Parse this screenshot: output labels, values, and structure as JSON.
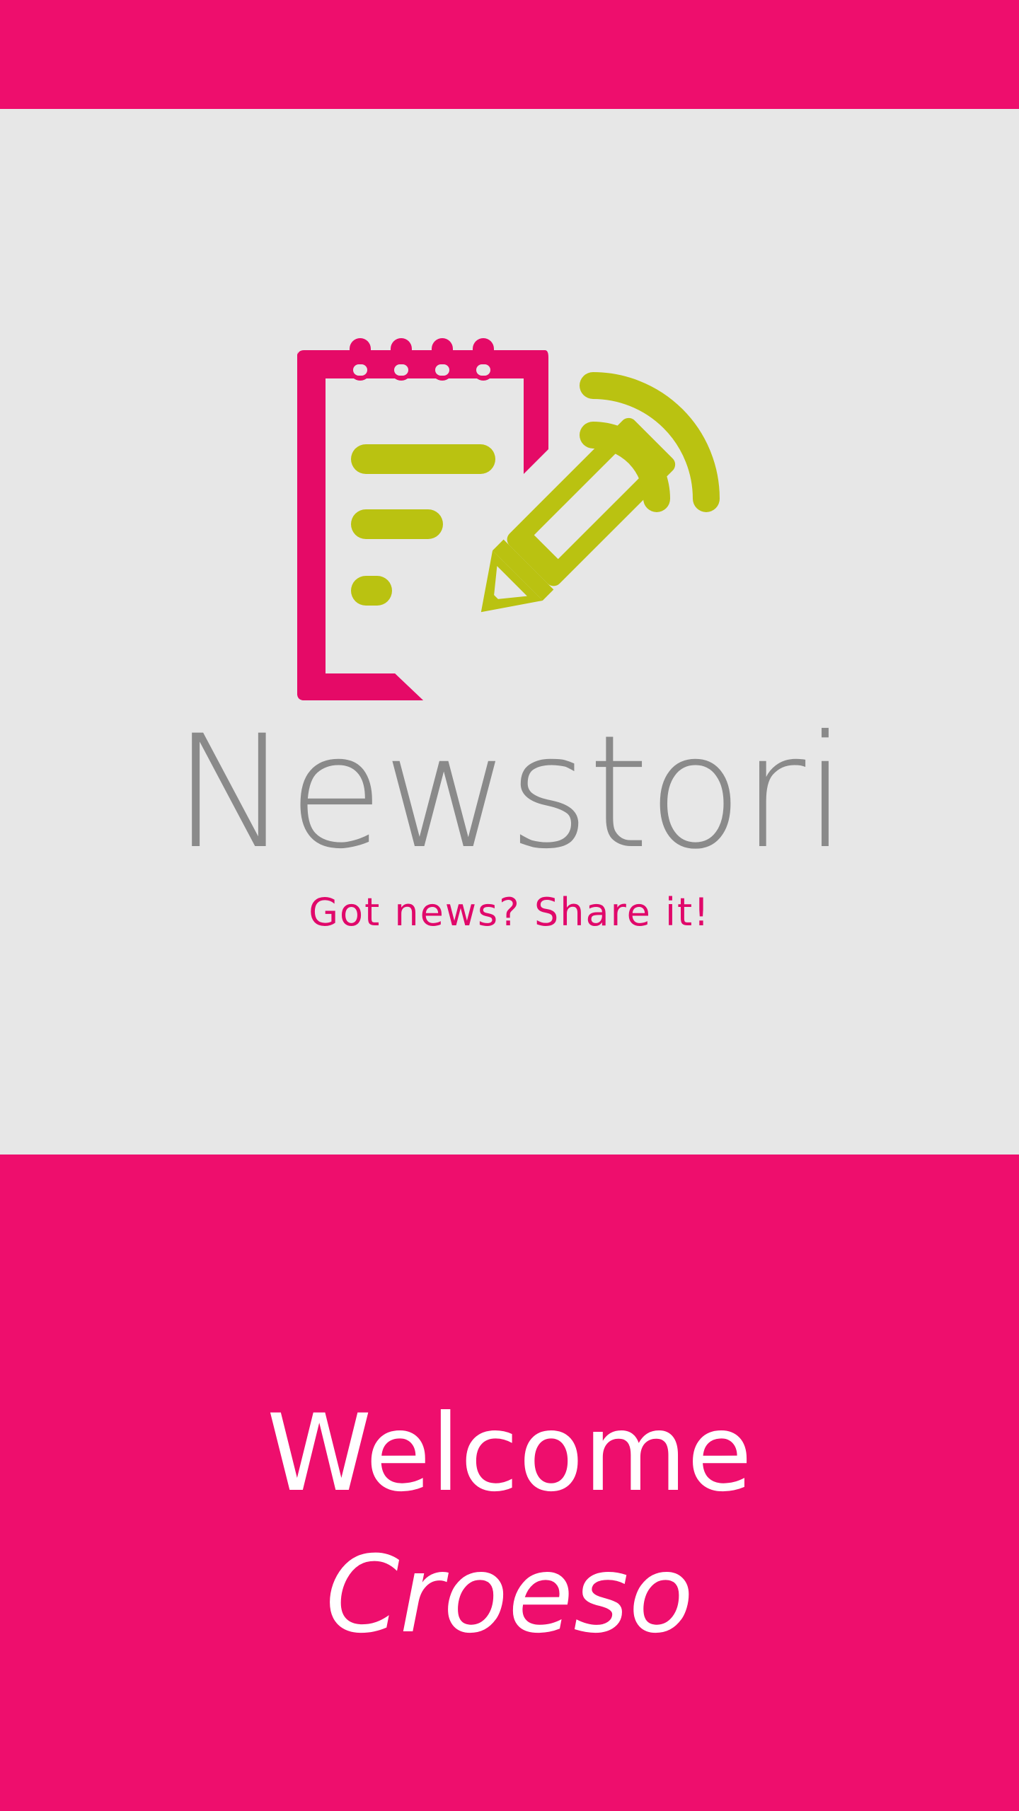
{
  "app": {
    "name": "Newstori",
    "tagline": "Got news? Share it!"
  },
  "welcome": {
    "line1": "Welcome",
    "line2": "Croeso"
  },
  "logo": {
    "icon": "notepad-pencil-broadcast-icon"
  },
  "colors": {
    "brand_pink": "#ee0e6d",
    "accent_lime": "#bac211",
    "text_gray": "#8a8a8a",
    "background": "#e7e7e7"
  }
}
